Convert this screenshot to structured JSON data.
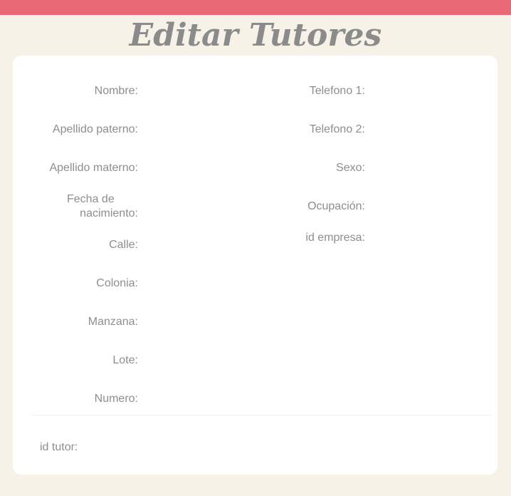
{
  "header": {
    "title": "Editar Tutores"
  },
  "form": {
    "left_fields": {
      "nombre": {
        "label": "Nombre:",
        "value": ""
      },
      "apellido_paterno": {
        "label": "Apellido paterno:",
        "value": ""
      },
      "apellido_materno": {
        "label": "Apellido materno:",
        "value": ""
      },
      "fecha_nacimiento": {
        "label_line1": "Fecha de",
        "label_line2": "nacimiento:",
        "value": ""
      },
      "calle": {
        "label": "Calle:",
        "value": ""
      },
      "colonia": {
        "label": "Colonia:",
        "value": ""
      },
      "manzana": {
        "label": "Manzana:",
        "value": ""
      },
      "lote": {
        "label": "Lote:",
        "value": ""
      },
      "numero": {
        "label": "Numero:",
        "value": ""
      }
    },
    "right_fields": {
      "telefono1": {
        "label": "Telefono 1:",
        "value": ""
      },
      "telefono2": {
        "label": "Telefono 2:",
        "value": ""
      },
      "sexo": {
        "label": "Sexo:",
        "value": ""
      },
      "ocupacion": {
        "label": "Ocupación:",
        "value": ""
      },
      "id_empresa": {
        "label": "id empresa:",
        "value": ""
      }
    },
    "footer": {
      "id_tutor": {
        "label": "id tutor:",
        "value": ""
      }
    }
  },
  "colors": {
    "top_bar": "#e96a76",
    "background": "#f6f2e8",
    "card": "#ffffff",
    "label": "#8e8e8e",
    "title": "#8b8b8b"
  }
}
